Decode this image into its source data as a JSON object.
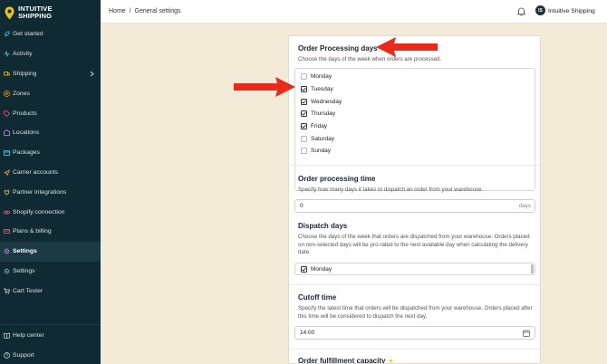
{
  "app": {
    "logo_line1": "INTUITIVE",
    "logo_line2": "SHIPPING"
  },
  "sidebar": {
    "items": [
      {
        "label": "Get started",
        "icon": "rocket-icon"
      },
      {
        "label": "Activity",
        "icon": "pulse-icon"
      },
      {
        "label": "Shipping",
        "icon": "truck-icon"
      },
      {
        "label": "Zones",
        "icon": "target-icon"
      },
      {
        "label": "Products",
        "icon": "tag-icon"
      },
      {
        "label": "Locations",
        "icon": "warehouse-icon"
      },
      {
        "label": "Packages",
        "icon": "box-icon"
      },
      {
        "label": "Carrier accounts",
        "icon": "plane-icon"
      },
      {
        "label": "Partner integrations",
        "icon": "plug-icon"
      },
      {
        "label": "Shopify connection",
        "icon": "link-icon"
      },
      {
        "label": "Plans & billing",
        "icon": "card-icon"
      },
      {
        "label": "Settings",
        "icon": "gear-icon"
      },
      {
        "label": "Settings",
        "icon": "gear-icon"
      },
      {
        "label": "Cart Tester",
        "icon": "cart-icon"
      }
    ],
    "bottom": [
      {
        "label": "Help center",
        "icon": "book-icon"
      },
      {
        "label": "Support",
        "icon": "help-icon"
      }
    ]
  },
  "topbar": {
    "breadcrumb_home": "Home",
    "breadcrumb_sep": "/",
    "breadcrumb_current": "General settings",
    "avatar_initials": "IS",
    "user_name": "Intuitive Shipping"
  },
  "processing_days": {
    "title": "Order Processing days",
    "description": "Choose the days of the week when orders are processed.",
    "days": [
      {
        "label": "Monday",
        "checked": false
      },
      {
        "label": "Tuesday",
        "checked": true
      },
      {
        "label": "Wednesday",
        "checked": true
      },
      {
        "label": "Thursday",
        "checked": true
      },
      {
        "label": "Friday",
        "checked": true
      },
      {
        "label": "Saturday",
        "checked": false
      },
      {
        "label": "Sunday",
        "checked": false
      }
    ]
  },
  "processing_time": {
    "title": "Order processing time",
    "description": "Specify how many days it takes to dispatch an order from your warehouse.",
    "value": "0",
    "suffix": "days"
  },
  "dispatch_days": {
    "title": "Dispatch days",
    "description": "Choose the days of the week that orders are dispatched from your warehouse. Orders placed on non-selected days will be pro-rated to the next available day when calculating the delivery date.",
    "first_day": "Monday"
  },
  "cutoff": {
    "title": "Cutoff time",
    "description": "Specify the latest time that orders will be dispatched from your warehouse. Orders placed after this time will be considered to dispatch the next day.",
    "value": "14:00"
  },
  "capacity": {
    "title": "Order fulfillment capacity"
  },
  "colors": {
    "sidebar_bg": "#0f2a33",
    "page_bg": "#f4ead8",
    "accent": "#e8c325",
    "arrow_red": "#e82a1c"
  }
}
